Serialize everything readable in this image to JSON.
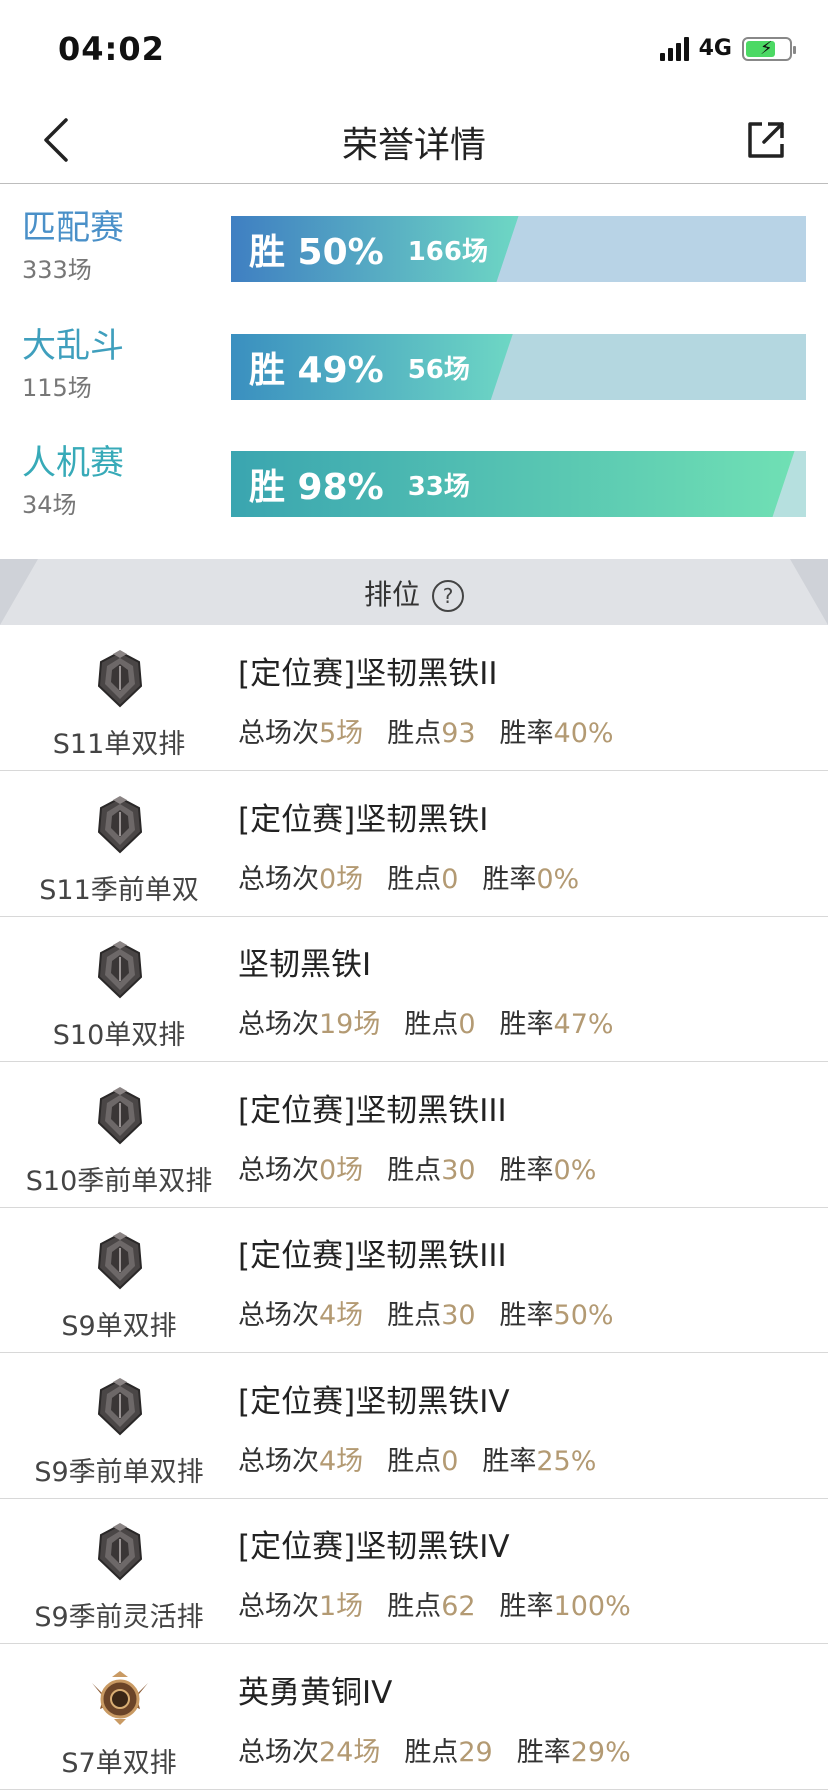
{
  "status": {
    "time": "04:02",
    "network": "4G"
  },
  "nav": {
    "title": "荣誉详情"
  },
  "modes": [
    {
      "name": "匹配赛",
      "count": "333场",
      "win_label": "胜 50%",
      "win_rate": 0.5,
      "games": "166场",
      "name_color": "#4a90c8",
      "bar_bg": "#b8d3e6",
      "fill_from": "#3f7fc2",
      "fill_to": "#6ed7c4"
    },
    {
      "name": "大乱斗",
      "count": "115场",
      "win_label": "胜 49%",
      "win_rate": 0.49,
      "games": "56场",
      "name_color": "#3f9fbd",
      "bar_bg": "#b4d7e0",
      "fill_from": "#3a8fc0",
      "fill_to": "#6ed7c4"
    },
    {
      "name": "人机赛",
      "count": "34场",
      "win_label": "胜 98%",
      "win_rate": 0.98,
      "games": "33场",
      "name_color": "#37aab8",
      "bar_bg": "#b6e0df",
      "fill_from": "#3aa5b0",
      "fill_to": "#70e0b4"
    }
  ],
  "ranked_header": {
    "label": "排位",
    "help": "?"
  },
  "labels": {
    "total": "总场次",
    "points": "胜点",
    "winrate": "胜率"
  },
  "ranked": [
    {
      "season": "S11单双排",
      "tier": "[定位赛]坚韧黑铁II",
      "total": "5场",
      "points": "93",
      "winrate": "40%",
      "emblem": "iron-emblem-icon"
    },
    {
      "season": "S11季前单双",
      "tier": "[定位赛]坚韧黑铁I",
      "total": "0场",
      "points": "0",
      "winrate": "0%",
      "emblem": "iron-emblem-icon"
    },
    {
      "season": "S10单双排",
      "tier": "坚韧黑铁I",
      "total": "19场",
      "points": "0",
      "winrate": "47%",
      "emblem": "iron-emblem-icon"
    },
    {
      "season": "S10季前单双排",
      "tier": "[定位赛]坚韧黑铁III",
      "total": "0场",
      "points": "30",
      "winrate": "0%",
      "emblem": "iron-emblem-icon"
    },
    {
      "season": "S9单双排",
      "tier": "[定位赛]坚韧黑铁III",
      "total": "4场",
      "points": "30",
      "winrate": "50%",
      "emblem": "iron-emblem-icon"
    },
    {
      "season": "S9季前单双排",
      "tier": "[定位赛]坚韧黑铁IV",
      "total": "4场",
      "points": "0",
      "winrate": "25%",
      "emblem": "iron-emblem-icon"
    },
    {
      "season": "S9季前灵活排",
      "tier": "[定位赛]坚韧黑铁IV",
      "total": "1场",
      "points": "62",
      "winrate": "100%",
      "emblem": "iron-emblem-icon"
    },
    {
      "season": "S7单双排",
      "tier": "英勇黄铜IV",
      "total": "24场",
      "points": "29",
      "winrate": "29%",
      "emblem": "bronze-emblem-icon"
    }
  ],
  "colors": {
    "stat_value": "#b39a73"
  }
}
